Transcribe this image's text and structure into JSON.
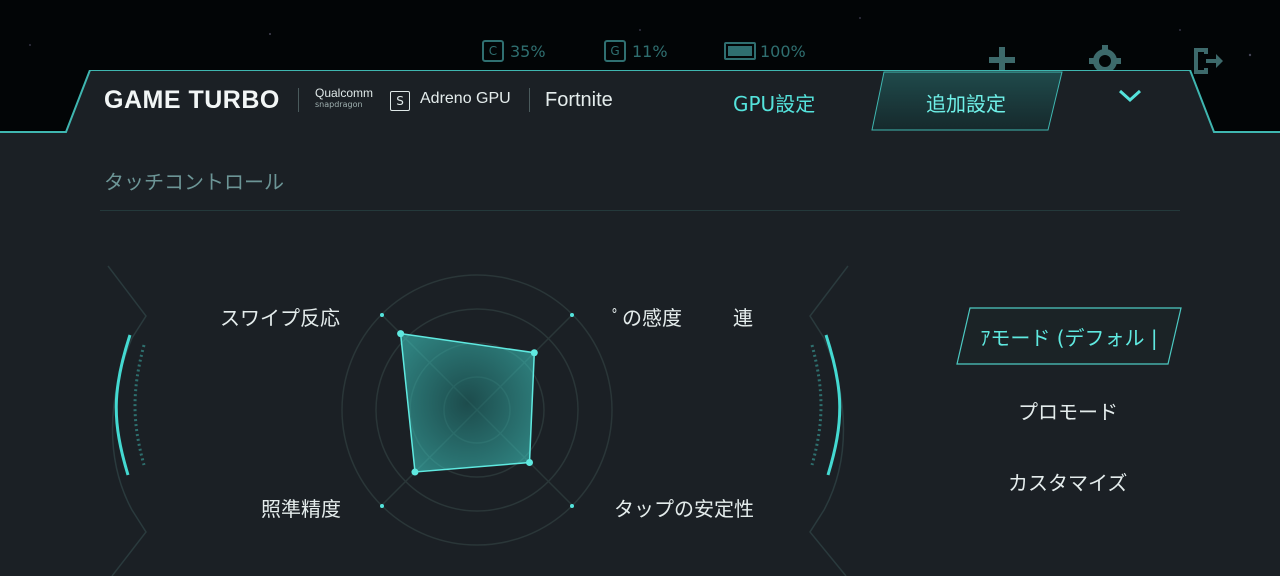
{
  "status_bar": {
    "cpu_label": "C",
    "cpu_value": "35%",
    "gpu_label": "G",
    "gpu_value": "11%",
    "battery_value": "100%"
  },
  "top_icons": [
    "plus-icon",
    "settings-gear-icon",
    "exit-icon"
  ],
  "header": {
    "brand": "GAME TURBO",
    "chip_brand_line1": "Qualcomm",
    "chip_brand_line2": "snapdragon",
    "gpu_name": "Adreno GPU",
    "game_name": "Fortnite",
    "tabs": [
      {
        "label": "GPU設定",
        "active": false
      },
      {
        "label": "追加設定",
        "active": true
      }
    ]
  },
  "section": {
    "title": "タッチコントロール"
  },
  "radar": {
    "labels": {
      "top_left": "スワイプ反応",
      "top_right": "ﾟの感度",
      "top_right_far": "連",
      "bottom_left": "照準精度",
      "bottom_right": "タップの安定性"
    },
    "values": {
      "swipe_response": 0.8,
      "sensitivity": 0.6,
      "tap_stability": 0.55,
      "aim_accuracy": 0.65
    }
  },
  "modes": {
    "selected": "ｱモード (デフォル |",
    "items": [
      "プロモード",
      "カスタマイズ"
    ]
  },
  "colors": {
    "accent": "#54e3dc",
    "panel_bg": "#1b2025",
    "muted": "#6c9596"
  }
}
